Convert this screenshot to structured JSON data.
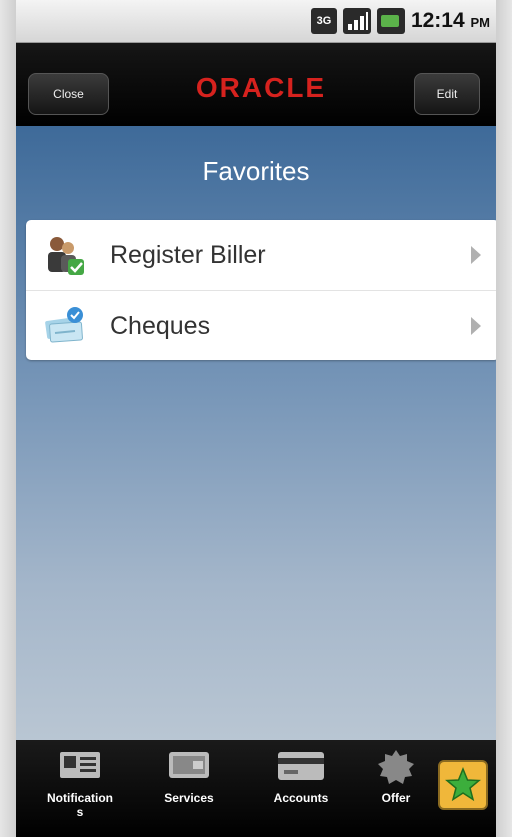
{
  "status_bar": {
    "network_label": "3G",
    "time": "12:14",
    "ampm": "PM",
    "icons": [
      "3g-icon",
      "signal-icon",
      "battery-icon"
    ]
  },
  "titlebar": {
    "close_label": "Close",
    "edit_label": "Edit",
    "logo_text": "ORACLE",
    "logo_color": "#d6221e"
  },
  "page": {
    "title": "Favorites"
  },
  "favorites": [
    {
      "label": "Register Biller",
      "icon": "register-biller-icon"
    },
    {
      "label": "Cheques",
      "icon": "cheques-icon"
    }
  ],
  "tabbar": {
    "tabs": [
      {
        "label": "Notification",
        "label2": "s",
        "icon": "notifications-icon"
      },
      {
        "label": "Services",
        "icon": "services-icon"
      },
      {
        "label": "Accounts",
        "icon": "accounts-icon"
      },
      {
        "label": "Offer",
        "icon": "offers-icon"
      }
    ],
    "favorites_icon": "star-icon",
    "favorites_color": "#f0b73a"
  }
}
